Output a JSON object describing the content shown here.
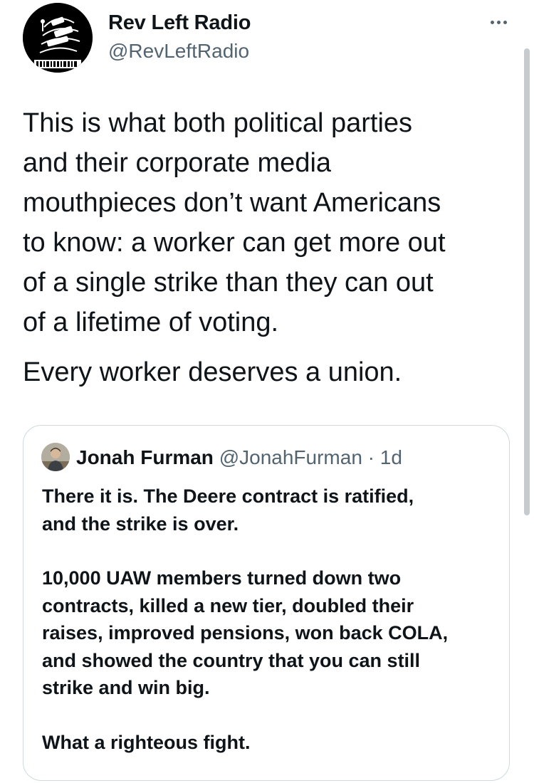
{
  "tweet": {
    "author_name": "Rev Left Radio",
    "author_handle": "@RevLeftRadio",
    "avatar_text": "REV LEFT",
    "paragraphs": [
      "This is what both political parties\nand their corporate media\nmouthpieces don’t want Americans\nto know: a worker can get more out\nof a single strike than they can out\nof a lifetime of voting.",
      "Every worker deserves a union."
    ]
  },
  "quoted_tweet": {
    "author_name": "Jonah Furman",
    "author_handle": "@JonahFurman",
    "separator": "·",
    "time": "1d",
    "paragraphs": [
      "There it is. The Deere contract is ratified,\nand the strike is over.",
      "10,000 UAW members turned down two\ncontracts, killed a new tier, doubled their\nraises, improved pensions, won back COLA,\nand showed the country that you can still\nstrike and win big.",
      "What a righteous fight."
    ]
  },
  "colors": {
    "text": "#0f1419",
    "secondary": "#536471",
    "border": "#cfd9de"
  },
  "icons": {
    "more": "more-horizontal-icon"
  }
}
